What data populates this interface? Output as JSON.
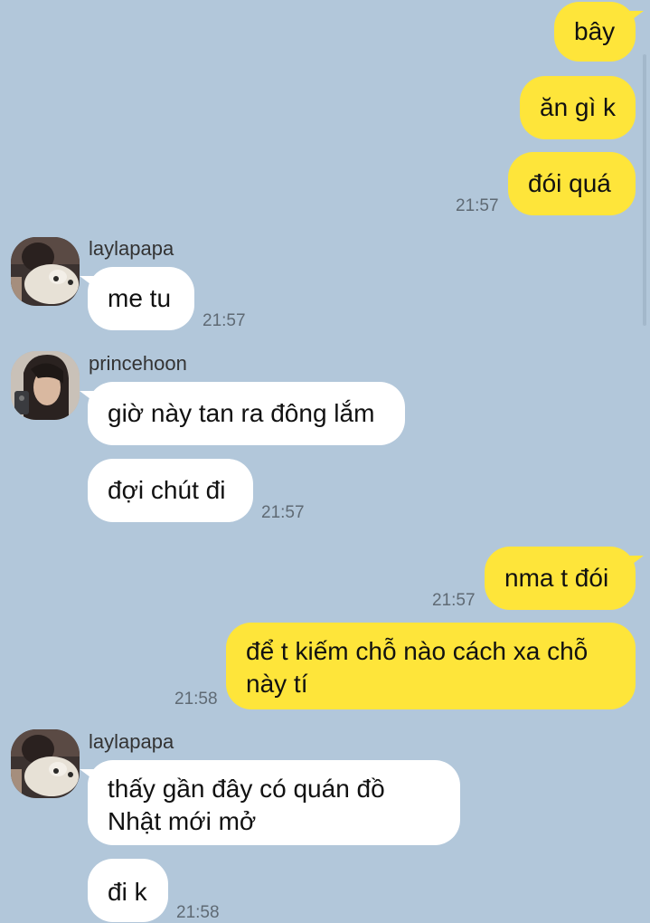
{
  "conversation": {
    "messages": [
      {
        "side": "me",
        "text": "bây"
      },
      {
        "side": "me",
        "text": "ăn gì k"
      },
      {
        "side": "me",
        "text": "đói quá",
        "time": "21:57"
      },
      {
        "side": "them",
        "sender": "laylapapa",
        "avatar": "laylapapa-avatar",
        "text": "me tu",
        "time": "21:57"
      },
      {
        "side": "them",
        "sender": "princehoon",
        "avatar": "princehoon-avatar",
        "text": "giờ này tan ra đông lắm"
      },
      {
        "side": "them",
        "text": "đợi chút đi",
        "time": "21:57"
      },
      {
        "side": "me",
        "text": "nma t đói",
        "time": "21:57"
      },
      {
        "side": "me",
        "text": "để t kiếm chỗ nào cách xa chỗ này tí",
        "time": "21:58"
      },
      {
        "side": "them",
        "sender": "laylapapa",
        "avatar": "laylapapa-avatar",
        "text": "thấy gần đây có quán đồ Nhật mới mở"
      },
      {
        "side": "them",
        "text": "đi k",
        "time": "21:58"
      }
    ]
  },
  "colors": {
    "background": "#b2c7da",
    "my_bubble": "#fee53a",
    "their_bubble": "#ffffff",
    "timestamp": "#5f6a74"
  }
}
